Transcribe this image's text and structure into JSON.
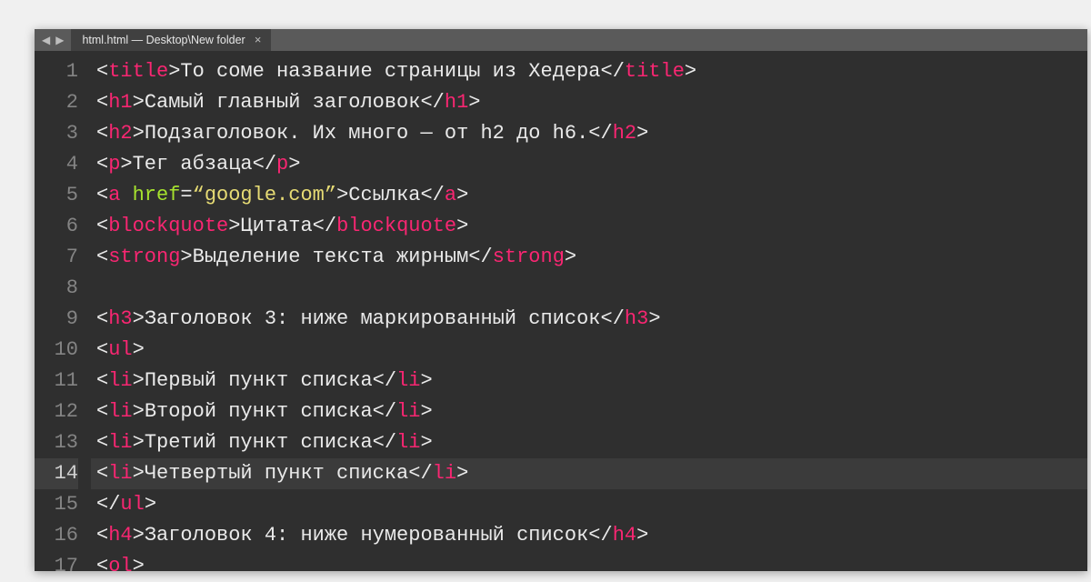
{
  "titlebar": {
    "nav_prev": "◀",
    "nav_next": "▶",
    "tab_label": "html.html — Desktop\\New folder",
    "tab_close": "×"
  },
  "active_line": 14,
  "lines": [
    {
      "n": 1,
      "tokens": [
        [
          "p",
          "<"
        ],
        [
          "t",
          "title"
        ],
        [
          "p",
          ">"
        ],
        [
          "tx",
          "То соме название страницы из Хедера"
        ],
        [
          "p",
          "</"
        ],
        [
          "t",
          "title"
        ],
        [
          "p",
          ">"
        ]
      ]
    },
    {
      "n": 2,
      "tokens": [
        [
          "p",
          "<"
        ],
        [
          "t",
          "h1"
        ],
        [
          "p",
          ">"
        ],
        [
          "tx",
          "Самый главный заголовок"
        ],
        [
          "p",
          "</"
        ],
        [
          "t",
          "h1"
        ],
        [
          "p",
          ">"
        ]
      ]
    },
    {
      "n": 3,
      "tokens": [
        [
          "p",
          "<"
        ],
        [
          "t",
          "h2"
        ],
        [
          "p",
          ">"
        ],
        [
          "tx",
          "Подзаголовок. Их много — от h2 до h6."
        ],
        [
          "p",
          "</"
        ],
        [
          "t",
          "h2"
        ],
        [
          "p",
          ">"
        ]
      ]
    },
    {
      "n": 4,
      "tokens": [
        [
          "p",
          "<"
        ],
        [
          "t",
          "p"
        ],
        [
          "p",
          ">"
        ],
        [
          "tx",
          "Тег абзаца"
        ],
        [
          "p",
          "</"
        ],
        [
          "t",
          "p"
        ],
        [
          "p",
          ">"
        ]
      ]
    },
    {
      "n": 5,
      "tokens": [
        [
          "p",
          "<"
        ],
        [
          "t",
          "a"
        ],
        [
          "p",
          " "
        ],
        [
          "at",
          "href"
        ],
        [
          "p",
          "="
        ],
        [
          "s",
          "“google.com”"
        ],
        [
          "p",
          ">"
        ],
        [
          "tx",
          "Ссылка"
        ],
        [
          "p",
          "</"
        ],
        [
          "t",
          "a"
        ],
        [
          "p",
          ">"
        ]
      ]
    },
    {
      "n": 6,
      "tokens": [
        [
          "p",
          "<"
        ],
        [
          "t",
          "blockquote"
        ],
        [
          "p",
          ">"
        ],
        [
          "tx",
          "Цитата"
        ],
        [
          "p",
          "</"
        ],
        [
          "t",
          "blockquote"
        ],
        [
          "p",
          ">"
        ]
      ]
    },
    {
      "n": 7,
      "tokens": [
        [
          "p",
          "<"
        ],
        [
          "t",
          "strong"
        ],
        [
          "p",
          ">"
        ],
        [
          "tx",
          "Выделение текста жирным"
        ],
        [
          "p",
          "</"
        ],
        [
          "t",
          "strong"
        ],
        [
          "p",
          ">"
        ]
      ]
    },
    {
      "n": 8,
      "tokens": []
    },
    {
      "n": 9,
      "tokens": [
        [
          "p",
          "<"
        ],
        [
          "t",
          "h3"
        ],
        [
          "p",
          ">"
        ],
        [
          "tx",
          "Заголовок 3: ниже маркированный список"
        ],
        [
          "p",
          "</"
        ],
        [
          "t",
          "h3"
        ],
        [
          "p",
          ">"
        ]
      ]
    },
    {
      "n": 10,
      "tokens": [
        [
          "p",
          "<"
        ],
        [
          "t",
          "ul"
        ],
        [
          "p",
          ">"
        ]
      ]
    },
    {
      "n": 11,
      "tokens": [
        [
          "p",
          "<"
        ],
        [
          "t",
          "li"
        ],
        [
          "p",
          ">"
        ],
        [
          "tx",
          "Первый пункт списка"
        ],
        [
          "p",
          "</"
        ],
        [
          "t",
          "li"
        ],
        [
          "p",
          ">"
        ]
      ]
    },
    {
      "n": 12,
      "tokens": [
        [
          "p",
          "<"
        ],
        [
          "t",
          "li"
        ],
        [
          "p",
          ">"
        ],
        [
          "tx",
          "Второй пункт списка"
        ],
        [
          "p",
          "</"
        ],
        [
          "t",
          "li"
        ],
        [
          "p",
          ">"
        ]
      ]
    },
    {
      "n": 13,
      "tokens": [
        [
          "p",
          "<"
        ],
        [
          "t",
          "li"
        ],
        [
          "p",
          ">"
        ],
        [
          "tx",
          "Третий пункт списка"
        ],
        [
          "p",
          "</"
        ],
        [
          "t",
          "li"
        ],
        [
          "p",
          ">"
        ]
      ]
    },
    {
      "n": 14,
      "tokens": [
        [
          "p",
          "<"
        ],
        [
          "t",
          "li"
        ],
        [
          "p",
          ">"
        ],
        [
          "tx",
          "Четвертый пункт списка"
        ],
        [
          "p",
          "</"
        ],
        [
          "t",
          "li"
        ],
        [
          "p",
          ">"
        ]
      ]
    },
    {
      "n": 15,
      "tokens": [
        [
          "p",
          "</"
        ],
        [
          "t",
          "ul"
        ],
        [
          "p",
          ">"
        ]
      ]
    },
    {
      "n": 16,
      "tokens": [
        [
          "p",
          "<"
        ],
        [
          "t",
          "h4"
        ],
        [
          "p",
          ">"
        ],
        [
          "tx",
          "Заголовок 4: ниже нумерованный список"
        ],
        [
          "p",
          "</"
        ],
        [
          "t",
          "h4"
        ],
        [
          "p",
          ">"
        ]
      ]
    },
    {
      "n": 17,
      "tokens": [
        [
          "p",
          "<"
        ],
        [
          "t",
          "ol"
        ],
        [
          "p",
          ">"
        ]
      ]
    }
  ]
}
